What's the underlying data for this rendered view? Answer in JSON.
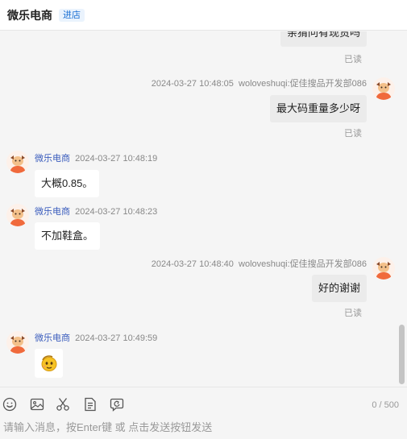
{
  "header": {
    "shop_name": "微乐电商",
    "enter_shop_label": "进店"
  },
  "messages": [
    {
      "id": "m0",
      "side": "right",
      "partial": true,
      "text": "亲猜问有现货吗",
      "read_label": "已读"
    },
    {
      "id": "m1",
      "side": "right",
      "time": "2024-03-27 10:48:05",
      "sender": "woloveshuqi:促佳搜品开发部086",
      "text": "最大码重量多少呀",
      "read_label": "已读"
    },
    {
      "id": "m2",
      "side": "left",
      "name": "微乐电商",
      "time": "2024-03-27 10:48:19",
      "text": "大概0.85。"
    },
    {
      "id": "m3",
      "side": "left",
      "name": "微乐电商",
      "time": "2024-03-27 10:48:23",
      "text": "不加鞋盒。"
    },
    {
      "id": "m4",
      "side": "right",
      "time": "2024-03-27 10:48:40",
      "sender": "woloveshuqi:促佳搜品开发部086",
      "text": "好的谢谢",
      "read_label": "已读"
    },
    {
      "id": "m5",
      "side": "left",
      "name": "微乐电商",
      "time": "2024-03-27 10:49:59",
      "sticker": "emoji-sticker"
    }
  ],
  "toolbar": {
    "icons": [
      "emoji-icon",
      "image-icon",
      "scissors-icon",
      "file-icon",
      "history-icon"
    ],
    "counter": "0 / 500"
  },
  "input": {
    "placeholder": "请输入消息，按Enter键 或 点击发送按钮发送",
    "value": ""
  },
  "colors": {
    "avatar_orange": "#f06a3c",
    "name_blue": "#3b5dbd",
    "enter_shop_blue": "#1a6fd3"
  }
}
